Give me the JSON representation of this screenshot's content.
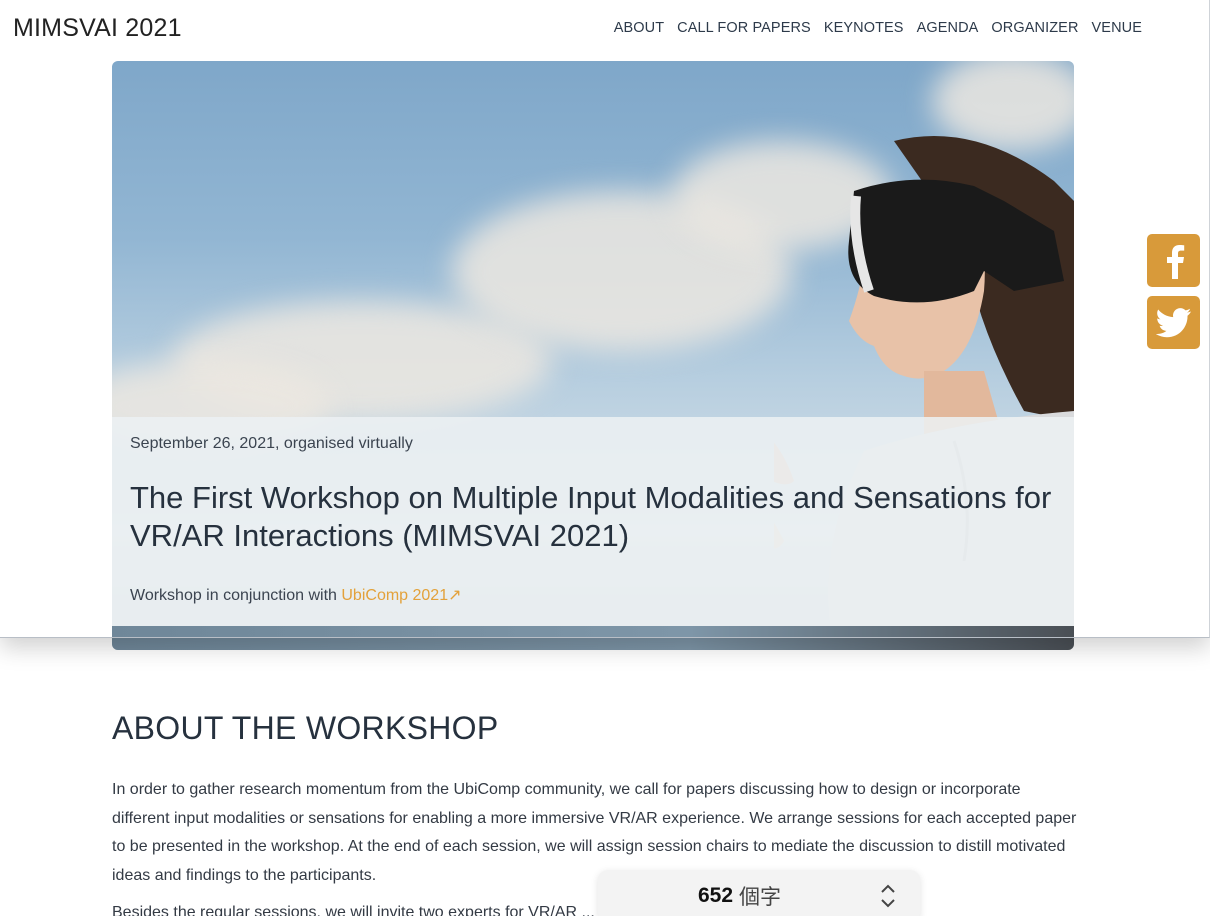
{
  "header": {
    "brand": "MIMSVAI 2021",
    "nav": [
      "ABOUT",
      "CALL FOR PAPERS",
      "KEYNOTES",
      "AGENDA",
      "ORGANIZER",
      "VENUE"
    ]
  },
  "hero": {
    "date": "September 26, 2021, organised virtually",
    "title": "The First Workshop on Multiple Input Modalities and Sensations for VR/AR Interactions (MIMSVAI 2021)",
    "conjunction_prefix": "Workshop in conjunction with ",
    "conjunction_link": "UbiComp 2021↗",
    "image_icon": "vr-headset-photo"
  },
  "social": {
    "facebook_icon": "facebook-icon",
    "twitter_icon": "twitter-icon",
    "color": "#d89a3a"
  },
  "about": {
    "heading": "ABOUT THE WORKSHOP",
    "paragraph": "In order to gather research momentum from the UbiComp community, we call for papers discussing how to design or incorporate different input modalities or sensations for enabling a more immersive VR/AR experience. We arrange sessions for each accepted paper to be presented in the workshop. At the end of each session, we will assign session chairs to mediate the discussion to distill motivated ideas and findings to the participants.",
    "paragraph2_partial": "Besides the regular sessions, we will invite two experts for VR/AR ..."
  },
  "word_count": {
    "value": "652",
    "unit": "個字"
  },
  "colors": {
    "accent": "#e3a13a",
    "social": "#d89a3a",
    "heading": "#26313e"
  }
}
